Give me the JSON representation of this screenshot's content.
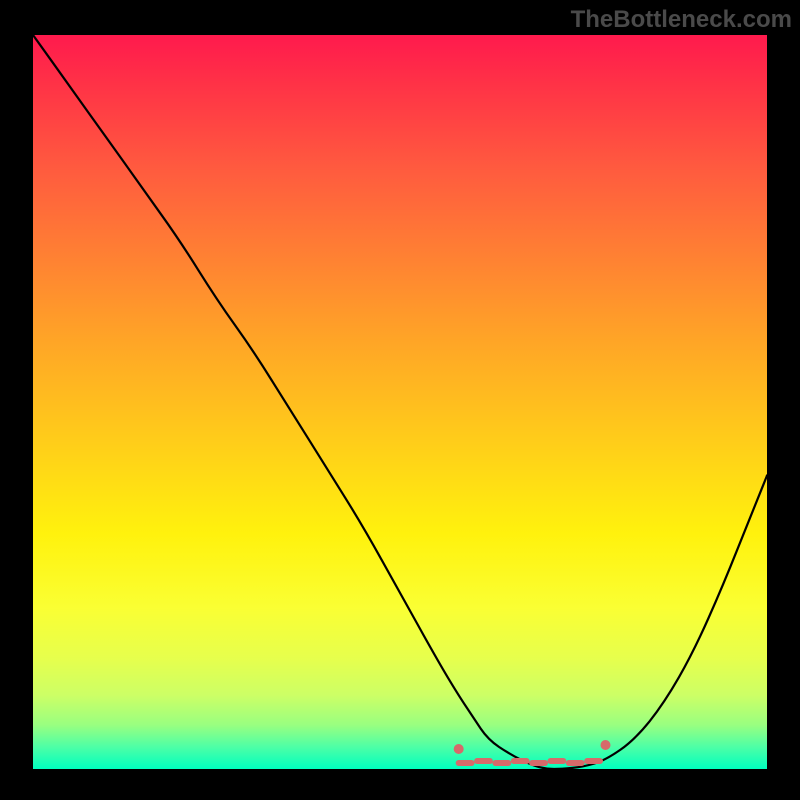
{
  "watermark": "TheBottleneck.com",
  "chart_data": {
    "type": "line",
    "title": "",
    "xlabel": "",
    "ylabel": "",
    "xlim": [
      0,
      100
    ],
    "ylim": [
      0,
      100
    ],
    "series": [
      {
        "name": "bottleneck-curve",
        "x": [
          0,
          5,
          10,
          15,
          20,
          25,
          30,
          35,
          40,
          45,
          50,
          55,
          58,
          60,
          62,
          65,
          68,
          70,
          72,
          75,
          78,
          82,
          86,
          90,
          94,
          98,
          100
        ],
        "values": [
          100,
          93,
          86,
          79,
          72,
          64,
          57,
          49,
          41,
          33,
          24,
          15,
          10,
          7,
          4,
          2,
          0.5,
          0,
          0,
          0.3,
          1.2,
          4,
          9,
          16,
          25,
          35,
          40
        ]
      }
    ],
    "flat_region": {
      "x_start": 58,
      "x_end": 78,
      "marker_color": "#d66a6a"
    },
    "background_gradient": [
      "#ff1a4d",
      "#ffcc1a",
      "#00ffbf"
    ]
  }
}
